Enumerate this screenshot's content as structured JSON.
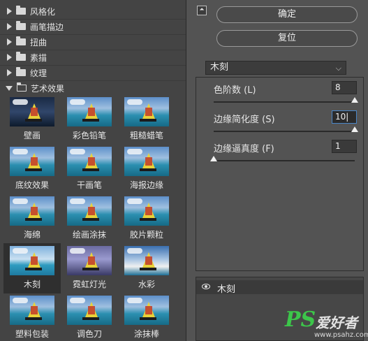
{
  "categories": [
    {
      "label": "风格化",
      "open": false
    },
    {
      "label": "画笔描边",
      "open": false
    },
    {
      "label": "扭曲",
      "open": false
    },
    {
      "label": "素描",
      "open": false
    },
    {
      "label": "纹理",
      "open": false
    },
    {
      "label": "艺术效果",
      "open": true
    }
  ],
  "filters": [
    {
      "label": "壁画"
    },
    {
      "label": "彩色铅笔"
    },
    {
      "label": "粗糙蜡笔"
    },
    {
      "label": "底纹效果"
    },
    {
      "label": "干画笔"
    },
    {
      "label": "海报边缘"
    },
    {
      "label": "海绵"
    },
    {
      "label": "绘画涂抹"
    },
    {
      "label": "胶片颗粒"
    },
    {
      "label": "木刻",
      "selected": true
    },
    {
      "label": "霓虹灯光"
    },
    {
      "label": "水彩"
    },
    {
      "label": "塑料包装"
    },
    {
      "label": "调色刀"
    },
    {
      "label": "涂抹棒"
    }
  ],
  "buttons": {
    "ok": "确定",
    "reset": "复位"
  },
  "collapse_icon": "double-chevron-up-icon",
  "filter_select": {
    "value": "木刻"
  },
  "params": [
    {
      "label": "色阶数 (L)",
      "value": "8",
      "level_fraction": 1.0
    },
    {
      "label": "边缘简化度 (S)",
      "value": "10|",
      "level_fraction": 1.0,
      "focused": true
    },
    {
      "label": "边缘逼真度 (F)",
      "value": "1",
      "level_fraction": 0.0
    }
  ],
  "effect_layer": {
    "label": "木刻"
  },
  "watermark": {
    "logo": "PS",
    "text": "爱好者",
    "url": "www.psahz.com"
  },
  "colors": {
    "panel": "#444444",
    "bg": "#535353",
    "selected": "#2f2f2f",
    "focus": "#4a86c7"
  }
}
